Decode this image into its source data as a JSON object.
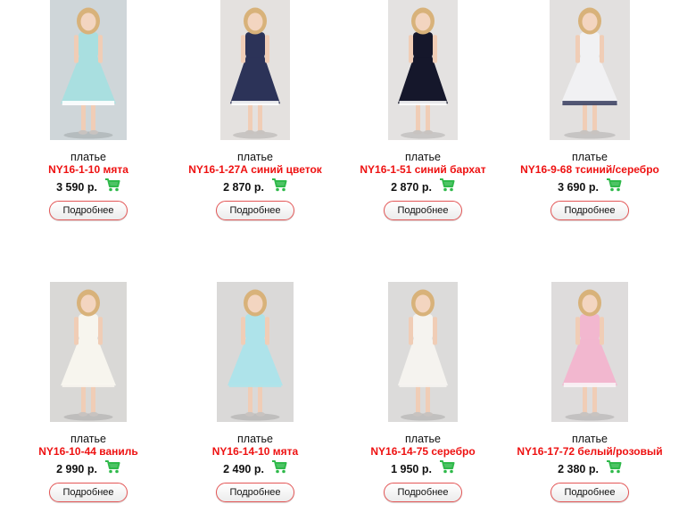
{
  "colors": {
    "sku_red": "#ee1111",
    "cart_green": "#2fb94a",
    "button_border": "#e25555"
  },
  "products": [
    {
      "category": "платье",
      "sku": "NY16-1-10 мята",
      "price": "3 590 р.",
      "button": "Подробнее",
      "cart_icon": "shopping-cart-icon",
      "photo": {
        "bg": "#cfd6d9",
        "dress": "#a9dfe0",
        "trim": "#ffffff"
      }
    },
    {
      "category": "платье",
      "sku": "NY16-1-27А синий цветок",
      "price": "2 870 р.",
      "button": "Подробнее",
      "cart_icon": "shopping-cart-icon",
      "photo": {
        "bg": "#e4e1df",
        "dress": "#2c3358",
        "trim": "#ffffff"
      }
    },
    {
      "category": "платье",
      "sku": "NY16-1-51 синий бархат",
      "price": "2 870 р.",
      "button": "Подробнее",
      "cart_icon": "shopping-cart-icon",
      "photo": {
        "bg": "#e4e2e1",
        "dress": "#15172b",
        "trim": "#ffffff"
      }
    },
    {
      "category": "платье",
      "sku": "NY16-9-68 тсиний/серебро",
      "price": "3 690 р.",
      "button": "Подробнее",
      "cart_icon": "shopping-cart-icon",
      "photo": {
        "bg": "#e2e0df",
        "dress": "#f1f1f3",
        "trim": "#3f4565"
      }
    },
    {
      "category": "платье",
      "sku": "NY16-10-44 ваниль",
      "price": "2 990 р.",
      "button": "Подробнее",
      "cart_icon": "shopping-cart-icon",
      "photo": {
        "bg": "#d9d8d6",
        "dress": "#f7f5ee",
        "trim": "#f7f5ee"
      }
    },
    {
      "category": "платье",
      "sku": "NY16-14-10 мята",
      "price": "2 490 р.",
      "button": "Подробнее",
      "cart_icon": "shopping-cart-icon",
      "photo": {
        "bg": "#dad9d8",
        "dress": "#aee3ea",
        "trim": "#aee3ea"
      }
    },
    {
      "category": "платье",
      "sku": "NY16-14-75 серебро",
      "price": "1 950 р.",
      "button": "Подробнее",
      "cart_icon": "shopping-cart-icon",
      "photo": {
        "bg": "#dcdbda",
        "dress": "#f5f3ef",
        "trim": "#f5f3ef"
      }
    },
    {
      "category": "платье",
      "sku": "NY16-17-72 белый/розовый",
      "price": "2 380 р.",
      "button": "Подробнее",
      "cart_icon": "shopping-cart-icon",
      "photo": {
        "bg": "#dedcdc",
        "dress": "#f2b7cf",
        "trim": "#f9f4f6"
      }
    }
  ]
}
